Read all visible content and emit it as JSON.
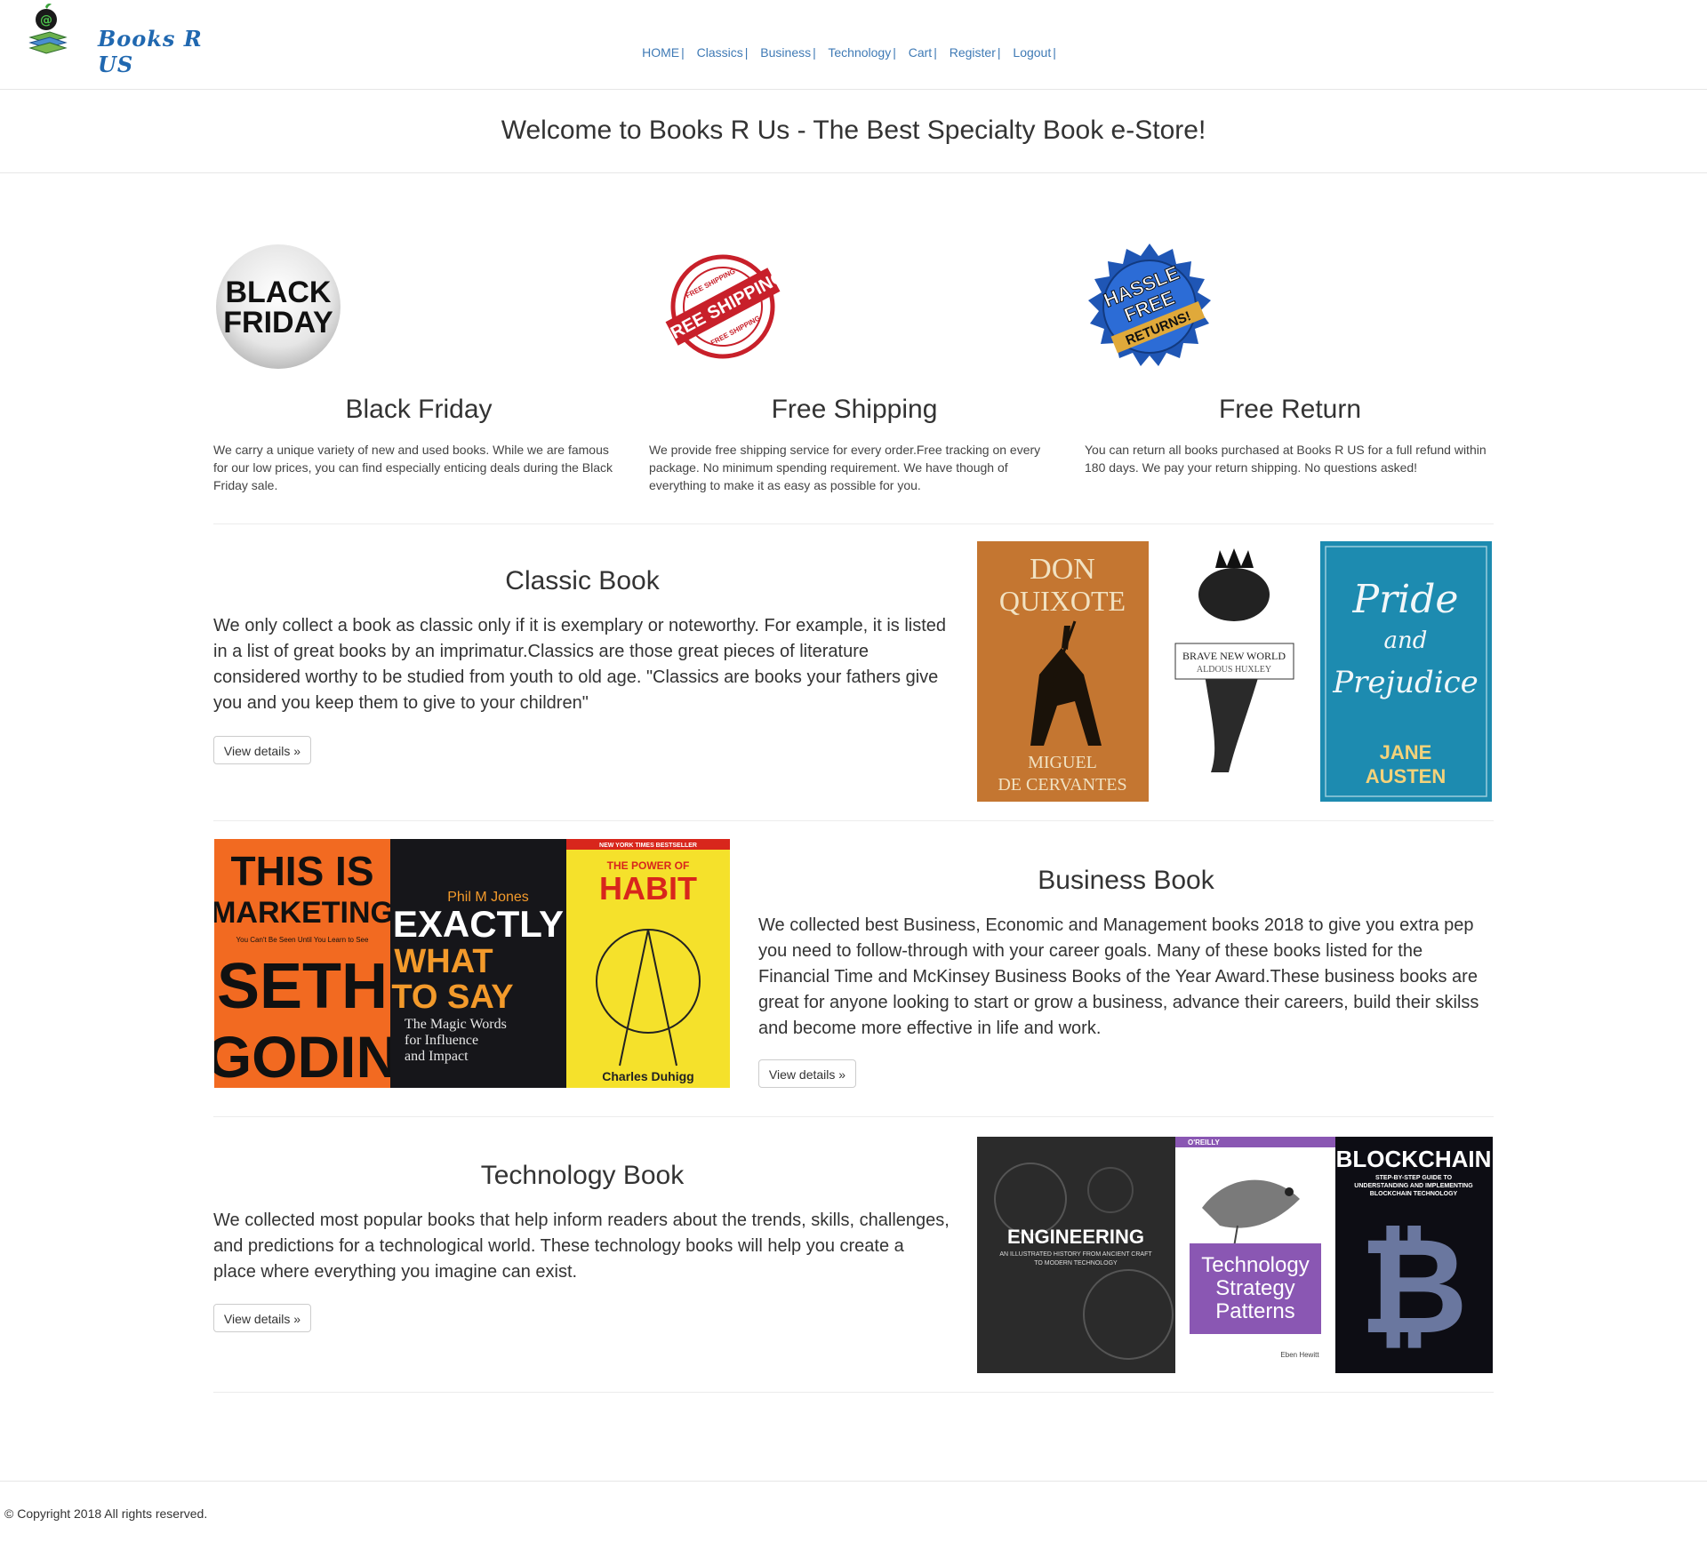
{
  "brand": {
    "logo_text": "Books R US"
  },
  "nav": {
    "items": [
      "HOME",
      "Classics",
      "Business",
      "Technology",
      "Cart",
      "Register",
      "Logout"
    ],
    "separator": "|"
  },
  "welcome": {
    "title": "Welcome to Books R Us - The Best Specialty Book e-Store!"
  },
  "features": [
    {
      "icon_text": [
        "BLACK",
        "FRIDAY"
      ],
      "title": "Black Friday",
      "text": "We carry a unique variety of new and used books. While we are famous for our low prices, you can find especially enticing deals during the Black Friday sale."
    },
    {
      "icon_text": [
        "FREE SHIPPING",
        "FREE SHIPPING",
        "FREE SHIPPING"
      ],
      "title": "Free Shipping",
      "text": "We provide free shipping service for every order.Free tracking on every package. No minimum spending requirement. We have though of everything to make it as easy as possible for you."
    },
    {
      "icon_text": [
        "HASSLE",
        "FREE",
        "RETURNS!"
      ],
      "title": "Free Return",
      "text": "You can return all books purchased at Books R US for a full refund within 180 days. We pay your return shipping. No questions asked!"
    }
  ],
  "sections": {
    "classic": {
      "title": "Classic Book",
      "text": "We only collect a book as classic only if it is exemplary or noteworthy. For example, it is listed in a list of great books by an imprimatur.Classics are those great pieces of literature considered worthy to be studied from youth to old age. \"Classics are books your fathers give you and you keep them to give to your children\"",
      "button": "View details »",
      "covers": [
        {
          "lines": [
            "DON",
            "QUIXOTE"
          ],
          "author": [
            "MIGUEL",
            "DE CERVANTES"
          ]
        },
        {
          "lines": [
            "BRAVE NEW WORLD"
          ],
          "author": [
            "ALDOUS HUXLEY"
          ]
        },
        {
          "lines": [
            "Pride",
            "and",
            "Prejudice"
          ],
          "author": [
            "JANE",
            "AUSTEN"
          ]
        }
      ]
    },
    "business": {
      "title": "Business Book",
      "text": "We collected best Business, Economic and Management books 2018 to give you extra pep you need to follow-through with your career goals. Many of these books listed for the Financial Time and McKinsey Business Books of the Year Award.These business books are great for anyone looking to start or grow a business, advance their careers, build their skilss and become more effective in life and work.",
      "button": "View details »",
      "covers": [
        {
          "lines": [
            "THIS IS",
            "MARKETING"
          ],
          "subtitle": "You Can't Be Seen Until You Learn to See",
          "author": [
            "SETH",
            "GODIN"
          ]
        },
        {
          "lines": [
            "EXACTLY",
            "WHAT",
            "TO SAY"
          ],
          "subtitle": [
            "The Magic Words",
            "for Influence",
            "and Impact"
          ],
          "author": [
            "Phil M Jones"
          ]
        },
        {
          "lines": [
            "THE POWER OF",
            "HABIT"
          ],
          "badge": "NEW YORK TIMES BESTSELLER",
          "author": [
            "Charles Duhigg"
          ]
        }
      ]
    },
    "technology": {
      "title": "Technology Book",
      "text": "We collected most popular books that help inform readers about the trends, skills, challenges, and predictions for a technological world. These technology books will help you create a place where everything you imagine can exist.",
      "button": "View details »",
      "covers": [
        {
          "lines": [
            "ENGINEERING"
          ],
          "subtitle": [
            "AN ILLUSTRATED HISTORY FROM ANCIENT CRAFT",
            "TO MODERN TECHNOLOGY"
          ]
        },
        {
          "lines": [
            "Technology",
            "Strategy",
            "Patterns"
          ],
          "badge": "O'REILLY",
          "author": [
            "Eben Hewitt"
          ]
        },
        {
          "lines": [
            "BLOCKCHAIN"
          ],
          "subtitle": [
            "STEP-BY-STEP GUIDE TO",
            "UNDERSTANDING AND IMPLEMENTING",
            "BLOCKCHAIN TECHNOLOGY"
          ]
        }
      ]
    }
  },
  "footer": {
    "copyright": "© Copyright 2018 All rights reserved."
  },
  "colors": {
    "link": "#3f7ab5",
    "logo": "#2068b0",
    "text": "#333333"
  }
}
